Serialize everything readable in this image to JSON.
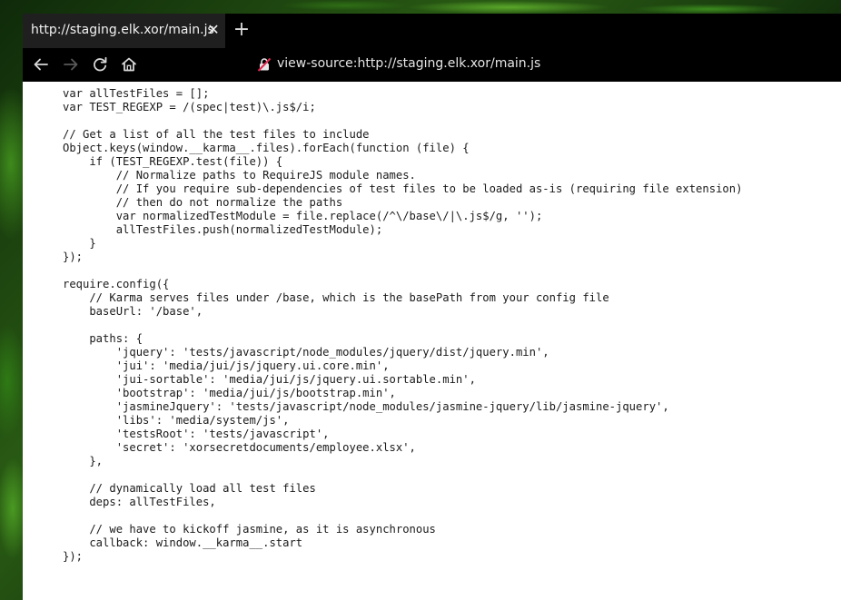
{
  "tab": {
    "title": "http://staging.elk.xor/main.js",
    "close_glyph": "✕",
    "new_tab_glyph": "+"
  },
  "toolbar": {
    "back_icon": "arrow-left-icon",
    "forward_icon": "arrow-right-icon",
    "reload_icon": "reload-icon",
    "home_icon": "home-icon",
    "address_url": "view-source:http://staging.elk.xor/main.js",
    "insecure_icon": "insecure-lock-icon"
  },
  "colors": {
    "browser_chrome": "#000000",
    "tab_bg": "#1f1f1f",
    "content_bg": "#ffffff",
    "insecure_red": "#e22850"
  },
  "source_lines": [
    "var allTestFiles = [];",
    "var TEST_REGEXP = /(spec|test)\\.js$/i;",
    "",
    "// Get a list of all the test files to include",
    "Object.keys(window.__karma__.files).forEach(function (file) {",
    "    if (TEST_REGEXP.test(file)) {",
    "        // Normalize paths to RequireJS module names.",
    "        // If you require sub-dependencies of test files to be loaded as-is (requiring file extension)",
    "        // then do not normalize the paths",
    "        var normalizedTestModule = file.replace(/^\\/base\\/|\\.js$/g, '');",
    "        allTestFiles.push(normalizedTestModule);",
    "    }",
    "});",
    "",
    "require.config({",
    "    // Karma serves files under /base, which is the basePath from your config file",
    "    baseUrl: '/base',",
    "",
    "    paths: {",
    "        'jquery': 'tests/javascript/node_modules/jquery/dist/jquery.min',",
    "        'jui': 'media/jui/js/jquery.ui.core.min',",
    "        'jui-sortable': 'media/jui/js/jquery.ui.sortable.min',",
    "        'bootstrap': 'media/jui/js/bootstrap.min',",
    "        'jasmineJquery': 'tests/javascript/node_modules/jasmine-jquery/lib/jasmine-jquery',",
    "        'libs': 'media/system/js',",
    "        'testsRoot': 'tests/javascript',",
    "        'secret': 'xorsecretdocuments/employee.xlsx',",
    "    },",
    "",
    "    // dynamically load all test files",
    "    deps: allTestFiles,",
    "",
    "    // we have to kickoff jasmine, as it is asynchronous",
    "    callback: window.__karma__.start",
    "});"
  ]
}
